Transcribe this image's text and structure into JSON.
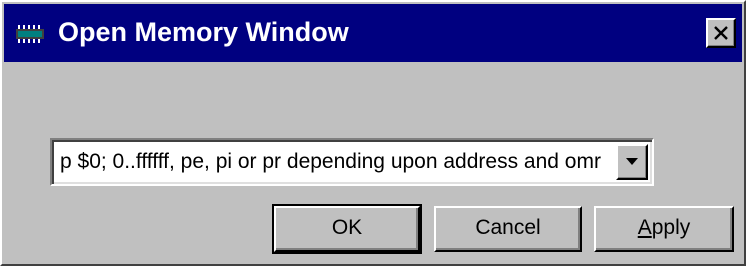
{
  "window": {
    "title": "Open Memory Window",
    "title_icon": "memory-chip-icon",
    "close_icon": "close-icon"
  },
  "address_combo": {
    "value": "p $0; 0..ffffff, pe, pi or pr depending upon address and omr",
    "dropdown_icon": "chevron-down-icon"
  },
  "buttons": {
    "ok_label": "OK",
    "cancel_label": "Cancel",
    "apply_label_accel": "A",
    "apply_label_rest": "pply"
  },
  "colors": {
    "titlebar": "#000080",
    "face": "#c0c0c0"
  }
}
